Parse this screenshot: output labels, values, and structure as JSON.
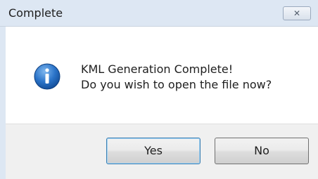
{
  "window": {
    "title": "Complete",
    "close_glyph": "✕"
  },
  "message": {
    "icon": "info-icon",
    "line1": "KML Generation Complete!",
    "line2": "Do you wish to open the file now?"
  },
  "buttons": {
    "yes_label": "Yes",
    "no_label": "No"
  },
  "colors": {
    "titlebar": "#dde7f3",
    "icon_blue": "#1d63b8",
    "footer": "#f0f0f0"
  }
}
